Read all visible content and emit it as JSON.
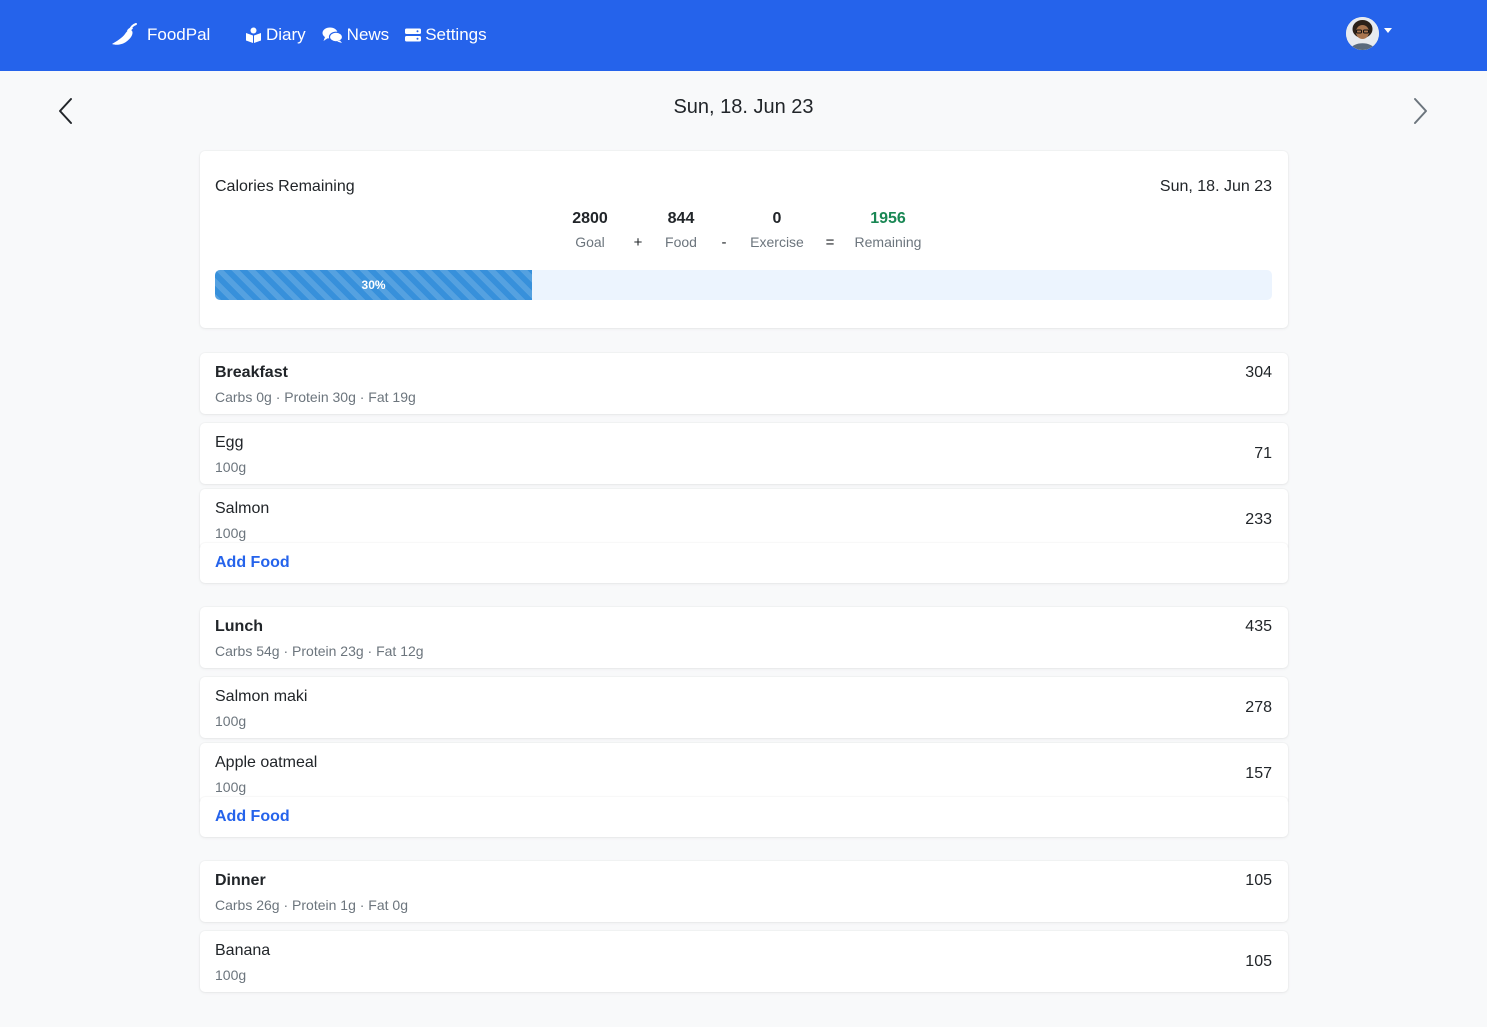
{
  "app": {
    "brand": "FoodPal",
    "accent": "#2563eb"
  },
  "nav": {
    "items": [
      {
        "label": "Diary",
        "icon": "book-reader-icon"
      },
      {
        "label": "News",
        "icon": "comments-icon"
      },
      {
        "label": "Settings",
        "icon": "server-icon"
      }
    ]
  },
  "date_nav": {
    "title": "Sun, 18. Jun 23"
  },
  "summary": {
    "title": "Calories Remaining",
    "date": "Sun, 18. Jun 23",
    "goal": {
      "value": "2800",
      "label": "Goal"
    },
    "food": {
      "value": "844",
      "label": "Food"
    },
    "exercise": {
      "value": "0",
      "label": "Exercise"
    },
    "remaining": {
      "value": "1956",
      "label": "Remaining",
      "color": "#198754"
    },
    "ops": [
      "+",
      "-",
      "="
    ],
    "progress": {
      "percent": 30,
      "label": "30%"
    }
  },
  "meals": [
    {
      "name": "Breakfast",
      "macros": "Carbs 0g · Protein 30g · Fat 19g",
      "calories": "304",
      "items": [
        {
          "name": "Egg",
          "amount": "100g",
          "calories": "71"
        },
        {
          "name": "Salmon",
          "amount": "100g",
          "calories": "233"
        }
      ],
      "add_label": "Add Food"
    },
    {
      "name": "Lunch",
      "macros": "Carbs 54g · Protein 23g · Fat 12g",
      "calories": "435",
      "items": [
        {
          "name": "Salmon maki",
          "amount": "100g",
          "calories": "278"
        },
        {
          "name": "Apple oatmeal",
          "amount": "100g",
          "calories": "157"
        }
      ],
      "add_label": "Add Food"
    },
    {
      "name": "Dinner",
      "macros": "Carbs 26g · Protein 1g · Fat 0g",
      "calories": "105",
      "items": [
        {
          "name": "Banana",
          "amount": "100g",
          "calories": "105"
        }
      ]
    }
  ]
}
